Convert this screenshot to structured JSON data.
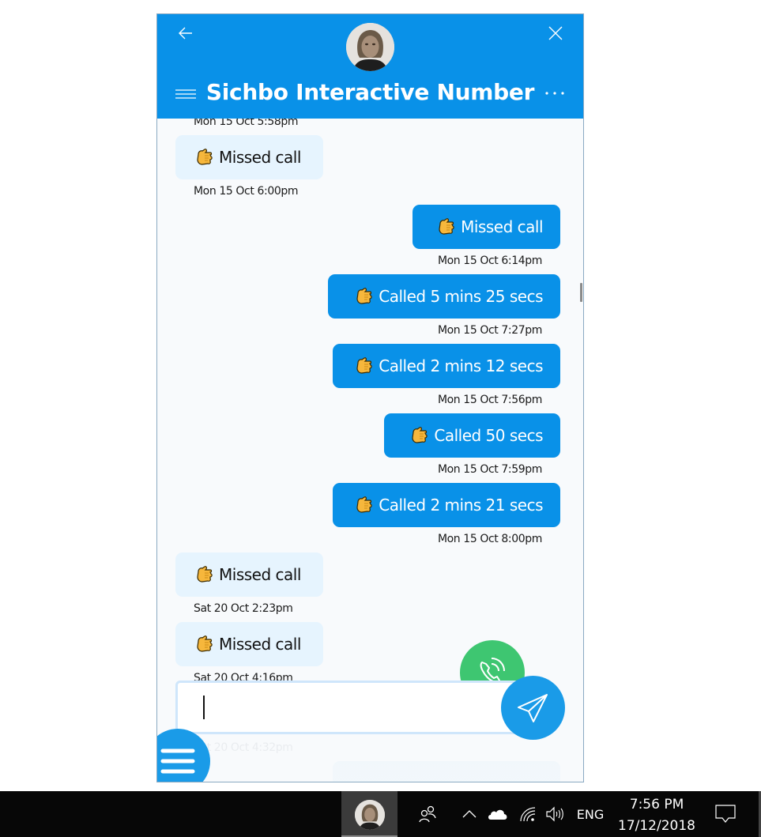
{
  "window": {
    "title": "Sichbo Interactive Number",
    "back_icon": "arrow-left-icon",
    "close_icon": "close-icon",
    "menu_icon": "hamburger-icon",
    "more_icon": "ellipsis-icon",
    "accent_color": "#0991e8"
  },
  "messages": [
    {
      "direction": "in",
      "text": null,
      "timestamp": "Mon 15 Oct 5:58pm"
    },
    {
      "direction": "in",
      "text": "Missed call",
      "timestamp": "Mon 15 Oct 6:00pm",
      "icon": "call-me-hand-icon"
    },
    {
      "direction": "out",
      "text": "Missed call",
      "timestamp": "Mon 15 Oct 6:14pm",
      "icon": "call-me-hand-icon"
    },
    {
      "direction": "out",
      "text": "Called 5 mins 25 secs",
      "timestamp": "Mon 15 Oct 7:27pm",
      "icon": "call-me-hand-icon"
    },
    {
      "direction": "out",
      "text": "Called 2 mins 12 secs",
      "timestamp": "Mon 15 Oct 7:56pm",
      "icon": "call-me-hand-icon"
    },
    {
      "direction": "out",
      "text": "Called 50 secs",
      "timestamp": "Mon 15 Oct 7:59pm",
      "icon": "call-me-hand-icon"
    },
    {
      "direction": "out",
      "text": "Called 2 mins 21 secs",
      "timestamp": "Mon 15 Oct 8:00pm",
      "icon": "call-me-hand-icon"
    },
    {
      "direction": "in",
      "text": "Missed call",
      "timestamp": "Sat 20 Oct 2:23pm",
      "icon": "call-me-hand-icon"
    },
    {
      "direction": "in",
      "text": "Missed call",
      "timestamp": "Sat 20 Oct 4:16pm",
      "icon": "call-me-hand-icon"
    },
    {
      "direction": "in",
      "text": null,
      "timestamp": "Sat 20 Oct 4:32pm"
    }
  ],
  "composer": {
    "value": "",
    "placeholder": "",
    "send_icon": "send-icon",
    "call_icon": "phone-call-icon",
    "menu_icon": "hamburger-icon",
    "call_color": "#3ec671",
    "send_color": "#1a9be8"
  },
  "taskbar": {
    "language": "ENG",
    "time": "7:56 PM",
    "date": "17/12/2018",
    "icons": [
      "people-icon",
      "chevron-up-icon",
      "onedrive-cloud-icon",
      "wifi-icon",
      "volume-icon",
      "action-center-icon"
    ]
  }
}
